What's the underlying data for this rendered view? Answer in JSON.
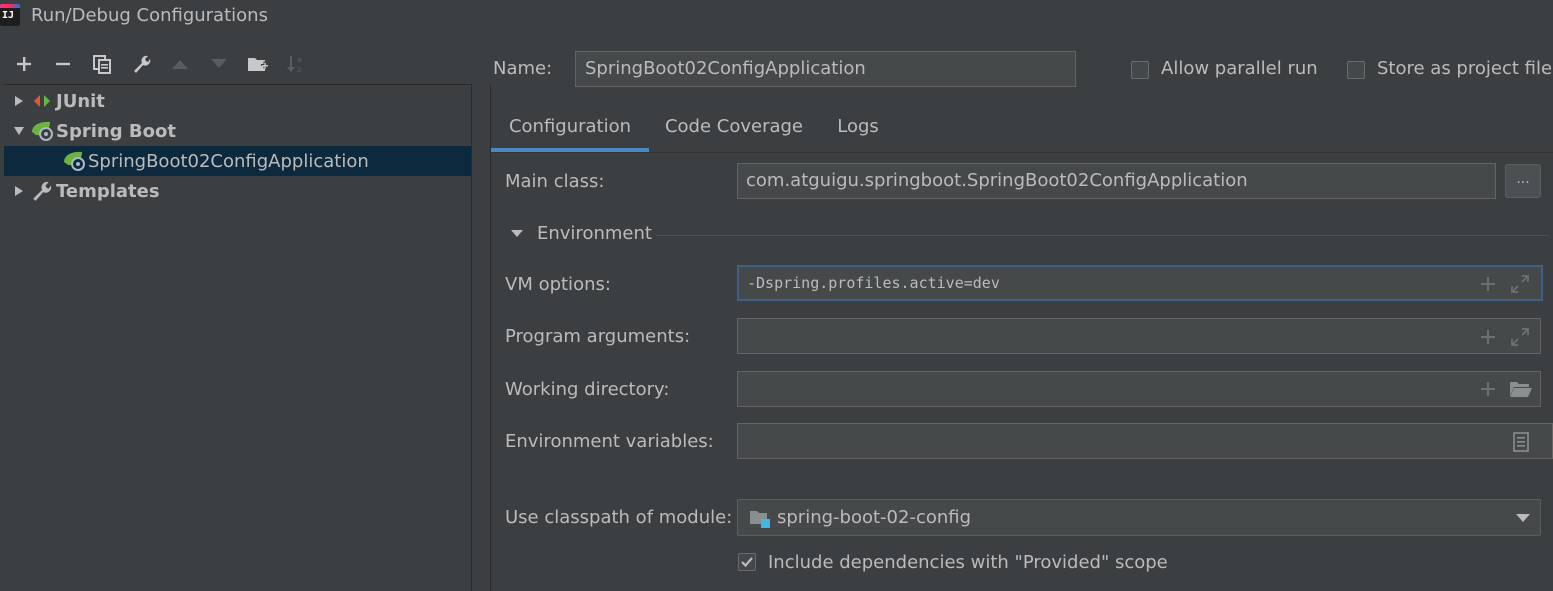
{
  "window": {
    "title": "Run/Debug Configurations",
    "app_icon_text": "IJ"
  },
  "toolbar": {
    "buttons": [
      "add-icon",
      "remove-icon",
      "copy-icon",
      "wrench-icon",
      "move-up-icon",
      "move-down-icon",
      "new-folder-icon",
      "sort-icon"
    ]
  },
  "tree": {
    "items": [
      {
        "label": "JUnit",
        "icon": "junit-icon",
        "expanded": false
      },
      {
        "label": "Spring Boot",
        "icon": "spring-boot-icon",
        "expanded": true
      },
      {
        "label": "SpringBoot02ConfigApplication",
        "icon": "spring-boot-app-icon",
        "selected": true
      },
      {
        "label": "Templates",
        "icon": "wrench-icon",
        "expanded": false
      }
    ]
  },
  "config": {
    "name_label": "Name:",
    "name_value": "SpringBoot02ConfigApplication",
    "allow_parallel_label": "Allow parallel run",
    "allow_parallel_checked": false,
    "store_project_label": "Store as project file",
    "store_project_checked": false
  },
  "tabs": [
    {
      "label": "Configuration",
      "active": true
    },
    {
      "label": "Code Coverage",
      "active": false
    },
    {
      "label": "Logs",
      "active": false
    }
  ],
  "form": {
    "main_class_label": "Main class:",
    "main_class_value": "com.atguigu.springboot.SpringBoot02ConfigApplication",
    "browse_label": "...",
    "environment_label": "Environment",
    "vm_options_label": "VM options:",
    "vm_options_value": "-Dspring.profiles.active=dev",
    "program_args_label": "Program arguments:",
    "program_args_value": "",
    "working_dir_label": "Working directory:",
    "working_dir_value": "",
    "env_vars_label": "Environment variables:",
    "env_vars_value": "",
    "classpath_label": "Use classpath of module:",
    "classpath_value": "spring-boot-02-config",
    "include_deps_label": "Include dependencies with \"Provided\" scope",
    "include_deps_checked": true
  },
  "colors": {
    "background": "#3c3f41",
    "selection": "#0d293e",
    "tab_underline": "#4a88c7",
    "focus_border": "#3d6185",
    "text": "#bbbbbb"
  }
}
